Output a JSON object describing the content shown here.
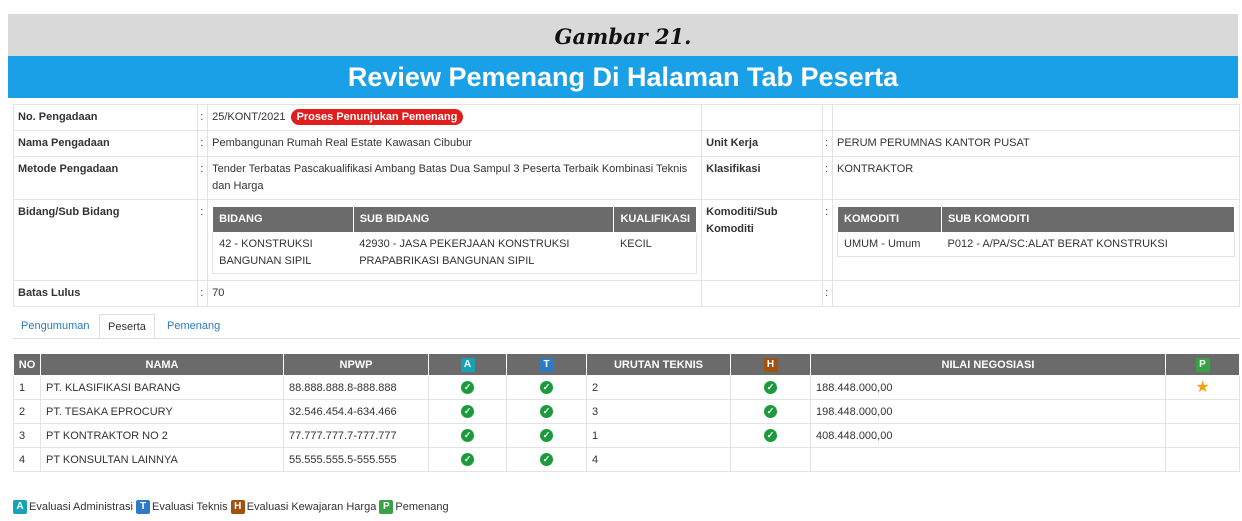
{
  "caption": "Gambar 21.",
  "banner": "Review Pemenang Di Halaman Tab Peserta",
  "info": {
    "no_pengadaan_label": "No. Pengadaan",
    "no_pengadaan": "25/KONT/2021",
    "status_badge": "Proses Penunjukan Pemenang",
    "nama_label": "Nama Pengadaan",
    "nama": "Pembangunan Rumah Real Estate Kawasan Cibubur",
    "unit_kerja_label": "Unit Kerja",
    "unit_kerja": "PERUM PERUMNAS KANTOR PUSAT",
    "metode_label": "Metode Pengadaan",
    "metode": "Tender Terbatas Pascakualifikasi Ambang Batas Dua Sampul 3 Peserta Terbaik Kombinasi Teknis dan Harga",
    "klasifikasi_label": "Klasifikasi",
    "klasifikasi": "KONTRAKTOR",
    "bidang_label": "Bidang/Sub Bidang",
    "bidang_headers": [
      "BIDANG",
      "SUB BIDANG",
      "KUALIFIKASI"
    ],
    "bidang_row": [
      "42 - KONSTRUKSI BANGUNAN SIPIL",
      "42930 - JASA PEKERJAAN KONSTRUKSI PRAPABRIKASI BANGUNAN SIPIL",
      "KECIL"
    ],
    "komoditi_label": "Komoditi/Sub Komoditi",
    "komoditi_headers": [
      "KOMODITI",
      "SUB KOMODITI"
    ],
    "komoditi_row": [
      "UMUM - Umum",
      "P012 - A/PA/SC:ALAT BERAT KONSTRUKSI"
    ],
    "batas_label": "Batas Lulus",
    "batas": "70",
    "sep": ":"
  },
  "tabs": [
    "Pengumuman",
    "Peserta",
    "Pemenang"
  ],
  "table": {
    "headers": [
      "NO",
      "NAMA",
      "NPWP",
      "A",
      "T",
      "URUTAN TEKNIS",
      "H",
      "NILAI NEGOSIASI",
      "P"
    ],
    "rows": [
      {
        "no": "1",
        "nama": "PT. KLASIFIKASI BARANG",
        "npwp": "88.888.888.8-888.888",
        "urutan": "2",
        "nilai": "188.448.000,00"
      },
      {
        "no": "2",
        "nama": "PT. TESAKA EPROCURY",
        "npwp": "32.546.454.4-634.466",
        "urutan": "3",
        "nilai": "198.448.000,00"
      },
      {
        "no": "3",
        "nama": "PT KONTRAKTOR NO 2",
        "npwp": "77.777.777.7-777.777",
        "urutan": "1",
        "nilai": "408.448.000,00"
      },
      {
        "no": "4",
        "nama": "PT KONSULTAN LAINNYA",
        "npwp": "55.555.555.5-555.555",
        "urutan": "4",
        "nilai": ""
      }
    ]
  },
  "legend": {
    "a_letter": "A",
    "a_text": "Evaluasi Administrasi",
    "t_letter": "T",
    "t_text": "Evaluasi Teknis",
    "h_letter": "H",
    "h_text": "Evaluasi Kewajaran Harga",
    "p_letter": "P",
    "p_text": "Pemenang"
  },
  "colors": {
    "banner": "#1aa0e6",
    "badge": "#e01e1e",
    "header": "#6b6b6b",
    "check": "#1c9b3c",
    "star": "#f4a20e"
  },
  "icons": {
    "check": "check-circle-icon",
    "winner": "star-icon"
  }
}
